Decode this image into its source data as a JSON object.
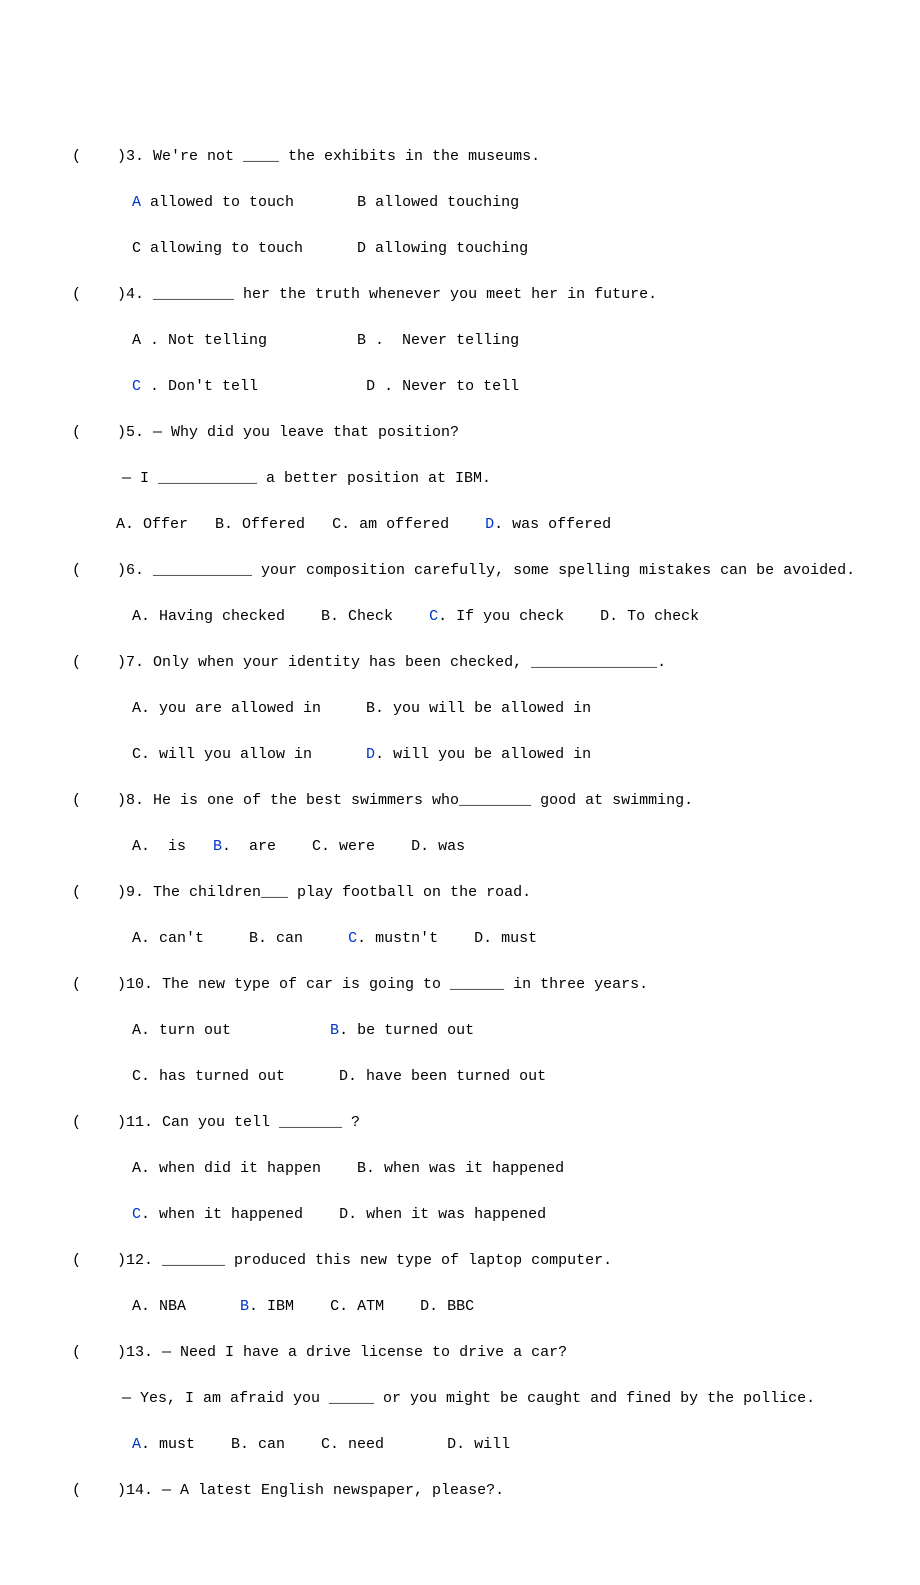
{
  "q3": {
    "prefix": "(    )3. We're not ____ the exhibits in the museums.",
    "optA_label": "A",
    "optA": " allowed to touch       ",
    "optB": "B allowed touching",
    "optC": "C allowing to touch      ",
    "optD": "D allowing touching"
  },
  "q4": {
    "prefix": "(    )4. _________ her the truth whenever you meet her in future.",
    "optA": "A . Not telling          ",
    "optB": "B .  Never telling",
    "optC_label": "C",
    "optC": " . Don't tell           ",
    "optD": " D . Never to tell"
  },
  "q5": {
    "prefix": "(    )5. — Why did you leave that position?",
    "sub": "— I ___________ a better position at IBM.",
    "optA": "A. Offer   ",
    "optB": "B. Offered   ",
    "optC": "C. am offered    ",
    "optD_label": "D",
    "optD": ". was offered"
  },
  "q6": {
    "prefix": "(    )6. ___________ your composition carefully, some spelling mistakes can be avoided.",
    "optA": "A. Having checked    ",
    "optB": "B. Check    ",
    "optC_label": "C",
    "optC": ". If you check    ",
    "optD": "D. To check"
  },
  "q7": {
    "prefix": "(    )7. Only when your identity has been checked, ______________.",
    "optA": "A. you are allowed in     ",
    "optB": "B. you will be allowed in",
    "optC": "C. will you allow in      ",
    "optD_label": "D",
    "optD": ". will you be allowed in"
  },
  "q8": {
    "prefix": "(    )8. He is one of the best swimmers who________ good at swimming.",
    "optA": "A.  is   ",
    "optB_label": "B",
    "optB": ".  are    ",
    "optC": "C. were    ",
    "optD": "D. was"
  },
  "q9": {
    "prefix": "(    )9. The children___ play football on the road.",
    "optA": "A. can't     ",
    "optB": "B. can     ",
    "optC_label": "C",
    "optC": ". mustn't    ",
    "optD": "D. must"
  },
  "q10": {
    "prefix": "(    )10. The new type of car is going to ______ in three years.",
    "optA": "A. turn out           ",
    "optB_label": "B",
    "optB": ". be turned out",
    "optC": "C. has turned out      ",
    "optD": "D. have been turned out"
  },
  "q11": {
    "prefix": "(    )11. Can you tell _______ ?",
    "optA": "A. when did it happen    ",
    "optB": "B. when was it happened",
    "optC_label": "C",
    "optC": ". when it happened    ",
    "optD": "D. when it was happened"
  },
  "q12": {
    "prefix": "(    )12. _______ produced this new type of laptop computer.",
    "optA": "A. NBA      ",
    "optB_label": "B",
    "optB": ". IBM    ",
    "optC": "C. ATM    ",
    "optD": "D. BBC"
  },
  "q13": {
    "prefix": "(    )13. — Need I have a drive license to drive a car?",
    "sub": "— Yes, I am afraid you _____ or you might be caught and fined by the pollice.",
    "optA_label": "A",
    "optA": ". must    ",
    "optB": "B. can    ",
    "optC": "C. need       ",
    "optD": "D. will"
  },
  "q14": {
    "prefix": "(    )14. — A latest English newspaper, please?."
  }
}
